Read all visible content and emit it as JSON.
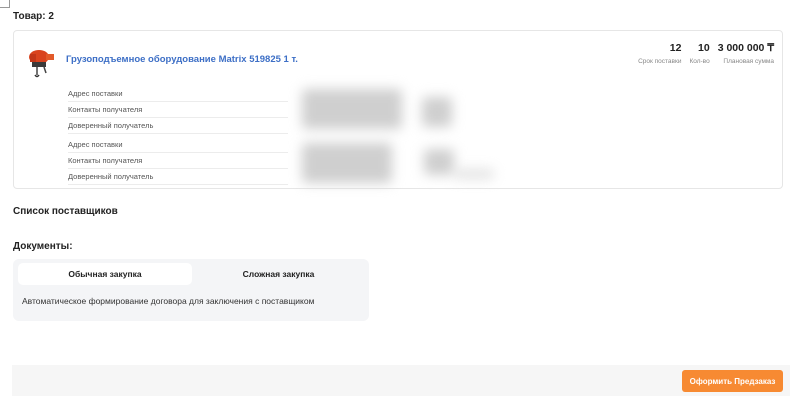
{
  "goods_section": {
    "title": "Товар: 2"
  },
  "product": {
    "title": "Грузоподъемное оборудование Matrix 519825 1 т.",
    "image_icon": "chain-hoist-image",
    "metrics": [
      {
        "value": "12",
        "label": "Срок поставки"
      },
      {
        "value": "10",
        "label": "Кол-во"
      },
      {
        "value": "3 000 000 ₸",
        "label": "Плановая сумма"
      }
    ],
    "info_groups": [
      {
        "rows": [
          "Адрес поставки",
          "Контакты получателя",
          "Доверенный получатель"
        ]
      },
      {
        "rows": [
          "Адрес поставки",
          "Контакты получателя",
          "Доверенный получатель"
        ]
      }
    ]
  },
  "suppliers_section": {
    "title": "Список поставщиков"
  },
  "documents_section": {
    "title": "Документы:",
    "tabs": [
      {
        "label": "Обычная закупка",
        "active": true
      },
      {
        "label": "Сложная закупка",
        "active": false
      }
    ],
    "description": "Автоматическое формирование договора для заключения с поставщиком"
  },
  "footer": {
    "submit_label": "Оформить Предзаказ"
  },
  "colors": {
    "link": "#3d6fc6",
    "accent": "#f78a32",
    "panel": "#f4f5f7"
  }
}
